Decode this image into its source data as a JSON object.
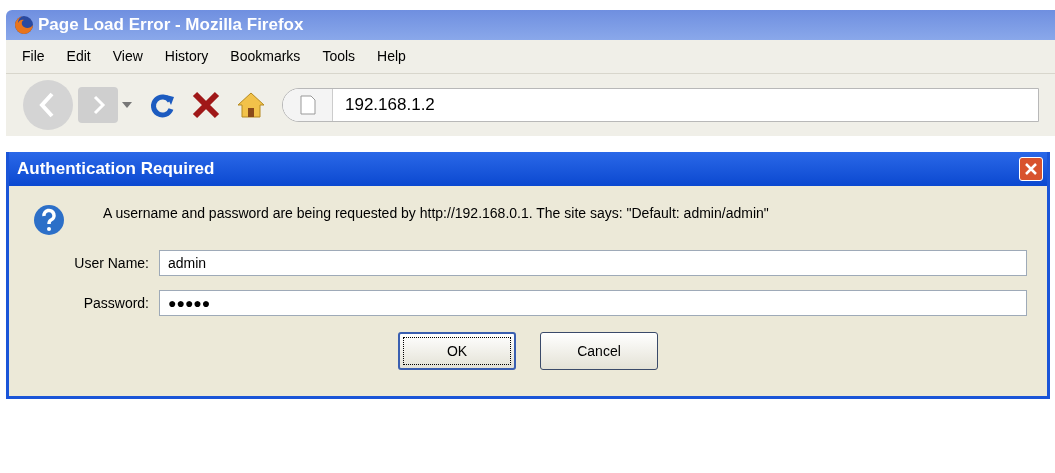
{
  "window": {
    "title": "Page Load Error - Mozilla Firefox"
  },
  "menu": [
    "File",
    "Edit",
    "View",
    "History",
    "Bookmarks",
    "Tools",
    "Help"
  ],
  "address": {
    "value": "192.168.1.2"
  },
  "dialog": {
    "title": "Authentication Required",
    "message": "A username and password are being requested by http://192.168.0.1. The site says: \"Default: admin/admin\"",
    "fields": [
      {
        "label": "User Name:",
        "value": "admin"
      },
      {
        "label": "Password:",
        "value": "●●●●●"
      }
    ],
    "buttons": [
      {
        "label": "OK",
        "selected": true
      },
      {
        "label": "Cancel",
        "selected": false
      }
    ]
  }
}
